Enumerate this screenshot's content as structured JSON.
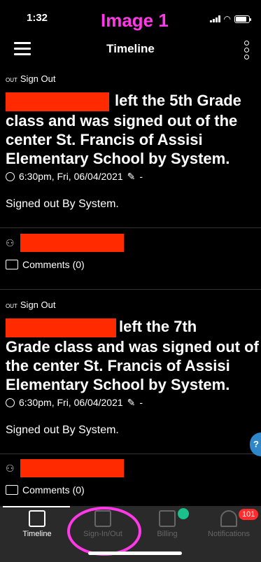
{
  "status_bar": {
    "time": "1:32",
    "overlay_label": "Image 1"
  },
  "header": {
    "title": "Timeline"
  },
  "cards": [
    {
      "tag": "Sign Out",
      "tag_prefix": "OUT",
      "headline": "left the 5th Grade class and was signed out of the center St. Francis of Assisi Elementary School by System.",
      "time_text": "6:30pm, Fri, 06/04/2021",
      "meta_suffix": "-",
      "description": "Signed out By System.",
      "comments_label": "Comments (0)"
    },
    {
      "tag": "Sign Out",
      "tag_prefix": "OUT",
      "headline_line1_suffix": "left the 7th",
      "headline_rest": "Grade class and was signed out of the center St. Francis of Assisi Elementary School by System.",
      "time_text": "6:30pm, Fri, 06/04/2021",
      "meta_suffix": "-",
      "description": "Signed out By System.",
      "comments_label": "Comments (0)"
    }
  ],
  "help": {
    "label": "?"
  },
  "tabs": [
    {
      "label": "Timeline",
      "active": true
    },
    {
      "label": "Sign-In/Out",
      "active": false
    },
    {
      "label": "Billing",
      "active": false
    },
    {
      "label": "Notifications",
      "active": false
    }
  ],
  "badges": {
    "notifications": "101"
  },
  "colors": {
    "redaction": "#ff2a00",
    "annotation": "#ff38e8",
    "billing_badge": "#1bbf8a",
    "notification_badge": "#ff2d2d"
  }
}
